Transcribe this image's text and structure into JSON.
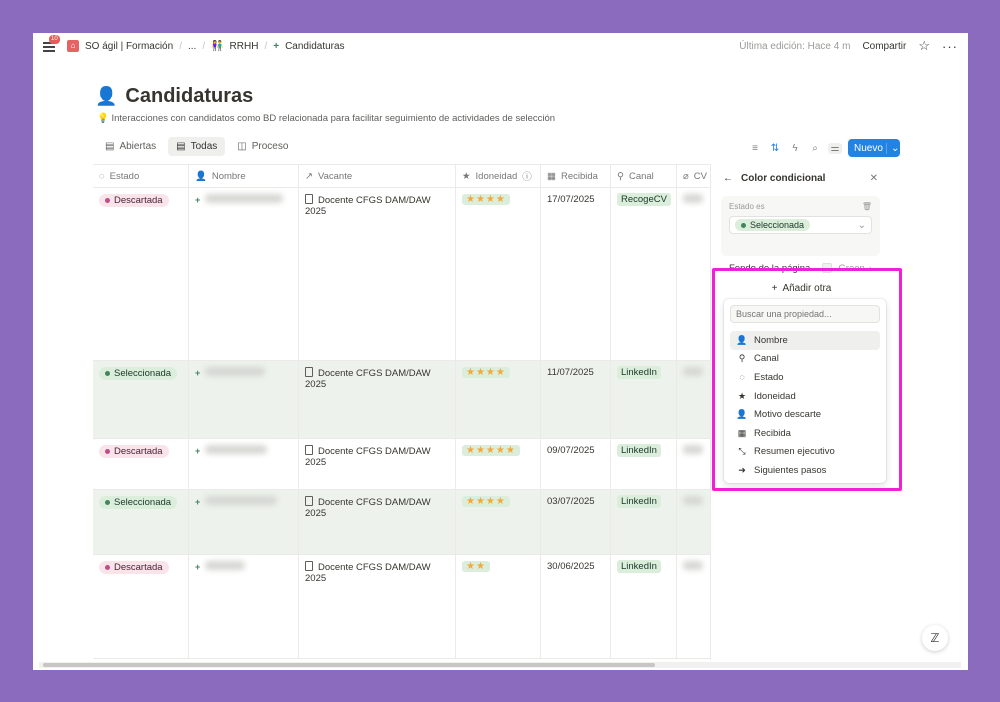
{
  "topbar": {
    "notif_count": "10",
    "breadcrumbs": [
      "SO ágil | Formación",
      "...",
      "RRHH",
      "Candidaturas"
    ],
    "last_edit": "Última edición: Hace 4 m",
    "share_label": "Compartir"
  },
  "page": {
    "title": "Candidaturas",
    "subtitle": "Interacciones con candidatos como BD relacionada para facilitar seguimiento de actividades de selección"
  },
  "tabs": [
    {
      "label": "Abiertas"
    },
    {
      "label": "Todas"
    },
    {
      "label": "Proceso"
    }
  ],
  "toolbar": {
    "new_label": "Nuevo"
  },
  "table": {
    "headers": [
      "Estado",
      "Nombre",
      "Vacante",
      "Idoneidad",
      "Recibida",
      "Canal",
      "CV"
    ],
    "rows": [
      {
        "estado": "Descartada",
        "vacante": "Docente CFGS DAM/DAW 2025",
        "stars": "★★★★",
        "recibida": "17/07/2025",
        "canal": "RecogeCV"
      },
      {
        "estado": "Seleccionada",
        "vacante": "Docente CFGS DAM/DAW 2025",
        "stars": "★★★★",
        "recibida": "11/07/2025",
        "canal": "LinkedIn"
      },
      {
        "estado": "Descartada",
        "vacante": "Docente CFGS DAM/DAW 2025",
        "stars": "★★★★★",
        "recibida": "09/07/2025",
        "canal": "LinkedIn"
      },
      {
        "estado": "Seleccionada",
        "vacante": "Docente CFGS DAM/DAW 2025",
        "stars": "★★★★",
        "recibida": "03/07/2025",
        "canal": "LinkedIn"
      },
      {
        "estado": "Descartada",
        "vacante": "Docente CFGS DAM/DAW 2025",
        "stars": "★★",
        "recibida": "30/06/2025",
        "canal": "LinkedIn"
      }
    ]
  },
  "panel": {
    "title": "Color condicional",
    "rule_label": "Estado es",
    "rule_value": "Seleccionada",
    "bg_label": "Fondo de la página",
    "bg_value": "Green",
    "add_other": "Añadir otra",
    "search_placeholder": "Buscar una propiedad...",
    "properties": [
      {
        "label": "Nombre",
        "icon": "person-add-icon"
      },
      {
        "label": "Canal",
        "icon": "person-walk-icon"
      },
      {
        "label": "Estado",
        "icon": "status-icon"
      },
      {
        "label": "Idoneidad",
        "icon": "star-icon"
      },
      {
        "label": "Motivo descarte",
        "icon": "person-remove-icon"
      },
      {
        "label": "Recibida",
        "icon": "calendar-icon"
      },
      {
        "label": "Resumen ejecutivo",
        "icon": "compress-icon"
      },
      {
        "label": "Siguientes pasos",
        "icon": "arrow-right-icon"
      }
    ]
  }
}
